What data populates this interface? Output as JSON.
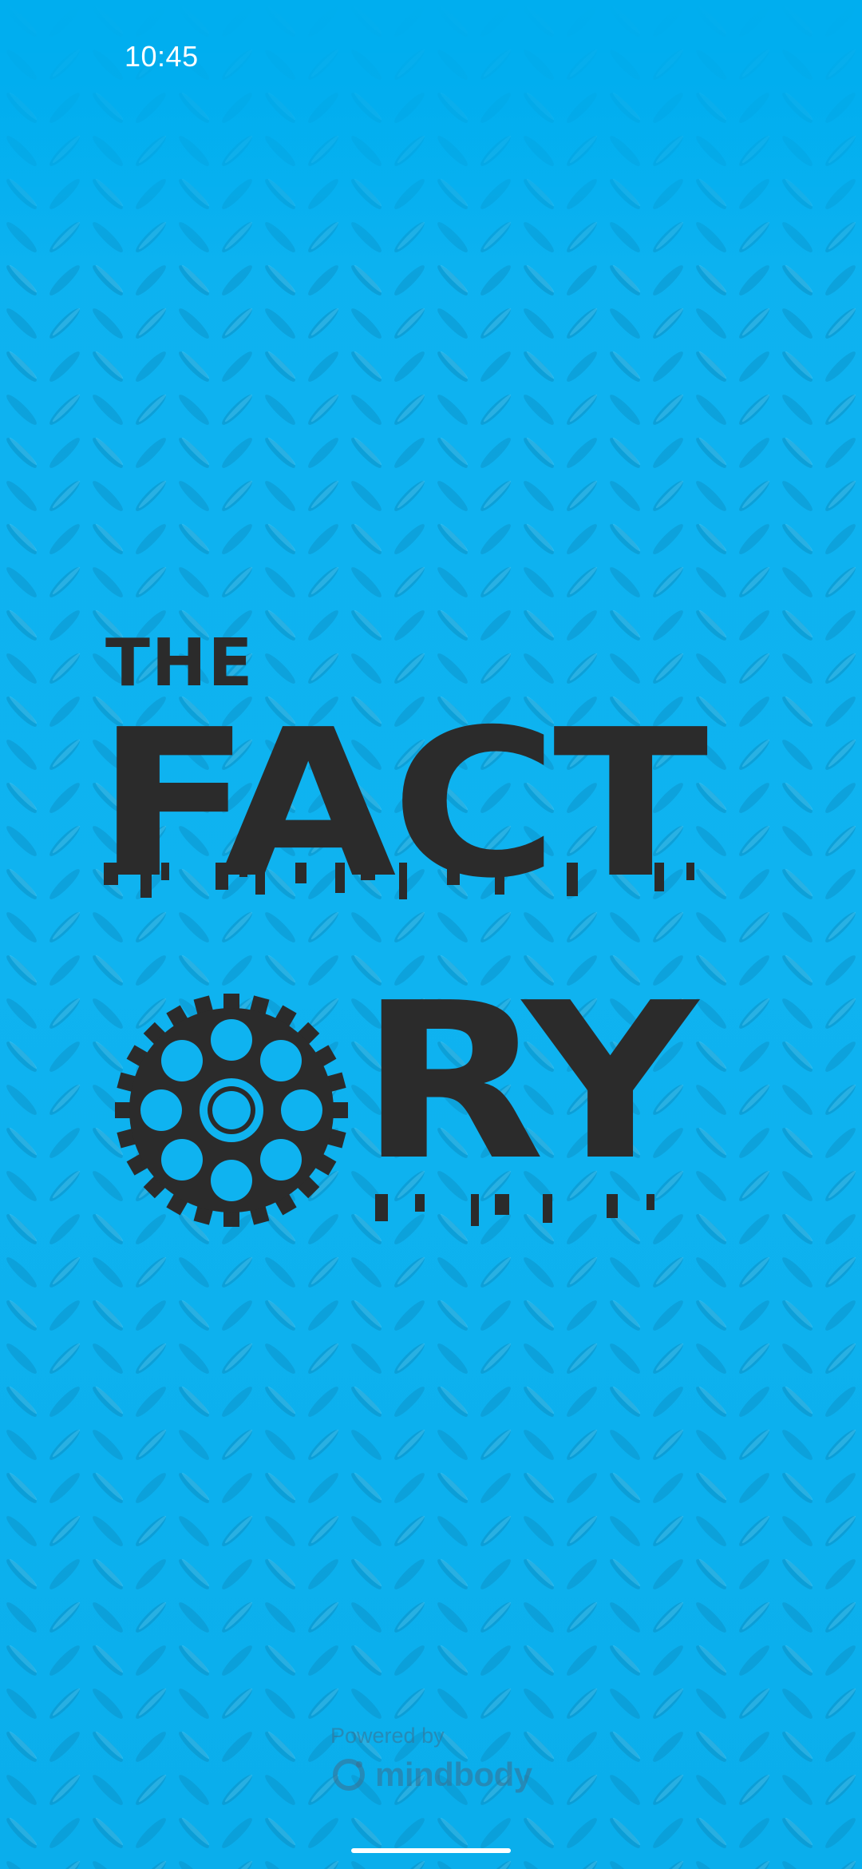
{
  "status_bar": {
    "time": "10:45"
  },
  "logo": {
    "line1": "THE",
    "line2": "FACT",
    "line3": "RY",
    "gear_icon": "gear-icon",
    "text_color": "#2b2b2b"
  },
  "footer": {
    "powered_by": "Powered by",
    "brand": "mindbody",
    "brand_icon": "mindbody-ring-icon"
  },
  "colors": {
    "background": "#00aeef",
    "logo": "#2b2b2b",
    "home_indicator": "#ffffff"
  }
}
